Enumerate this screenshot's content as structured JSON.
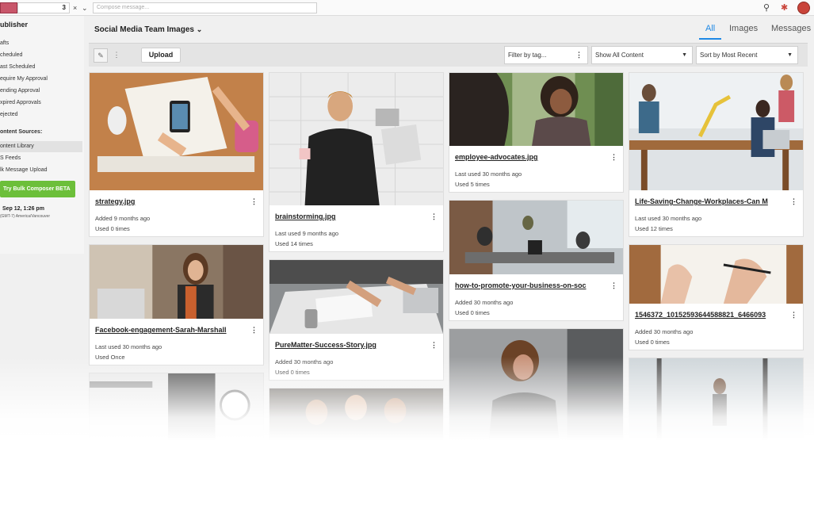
{
  "topbar": {
    "profile_count": "3",
    "compose_placeholder": "Compose message..."
  },
  "sidebar": {
    "title": "ublisher",
    "items": [
      "afts",
      "cheduled",
      "ast Scheduled",
      "equire My Approval",
      "ending Approval",
      "xpired Approvals",
      "ejected"
    ],
    "content_sources_label": "ontent Sources:",
    "sources": [
      "ontent Library",
      "S Feeds",
      "lk Message Upload"
    ],
    "cta_label": "Try Bulk Composer BETA",
    "date": "Sep 12, 1:26 pm",
    "timezone": "(GMT-7) America/Vancouver"
  },
  "header": {
    "library_title": "Social Media Team Images",
    "tabs": [
      "All",
      "Images",
      "Messages"
    ],
    "active_tab": "All"
  },
  "toolbar": {
    "upload_label": "Upload",
    "filter_placeholder": "Filter by tag...",
    "content_select": "Show All Content",
    "sort_select": "Sort by Most Recent"
  },
  "cards": [
    {
      "name": "strategy.jpg",
      "line1": "Added 9 months ago",
      "line2": "Used 0 times"
    },
    {
      "name": "Facebook-engagement-Sarah-Marshall",
      "line1": "Last used 30 months ago",
      "line2": "Used Once"
    },
    {
      "name": "brainstorming.jpg",
      "line1": "Last used 9 months ago",
      "line2": "Used 14 times"
    },
    {
      "name": "PureMatter-Success-Story.jpg",
      "line1": "Added 30 months ago",
      "line2": "Used 0 times"
    },
    {
      "name": "employee-advocates.jpg",
      "line1": "Last used 30 months ago",
      "line2": "Used 5 times"
    },
    {
      "name": "how-to-promote-your-business-on-soc",
      "line1": "Added 30 months ago",
      "line2": "Used 0 times"
    },
    {
      "name": "Life-Saving-Change-Workplaces-Can M",
      "line1": "Last used 30 months ago",
      "line2": "Used 12 times"
    },
    {
      "name": "1546372_10152593644588821_6466093",
      "line1": "Added 30 months ago",
      "line2": "Used 0 times"
    }
  ],
  "colors": {
    "accent": "#1e88e5",
    "cta": "#6cbf3a",
    "avatar": "#c9443a"
  }
}
